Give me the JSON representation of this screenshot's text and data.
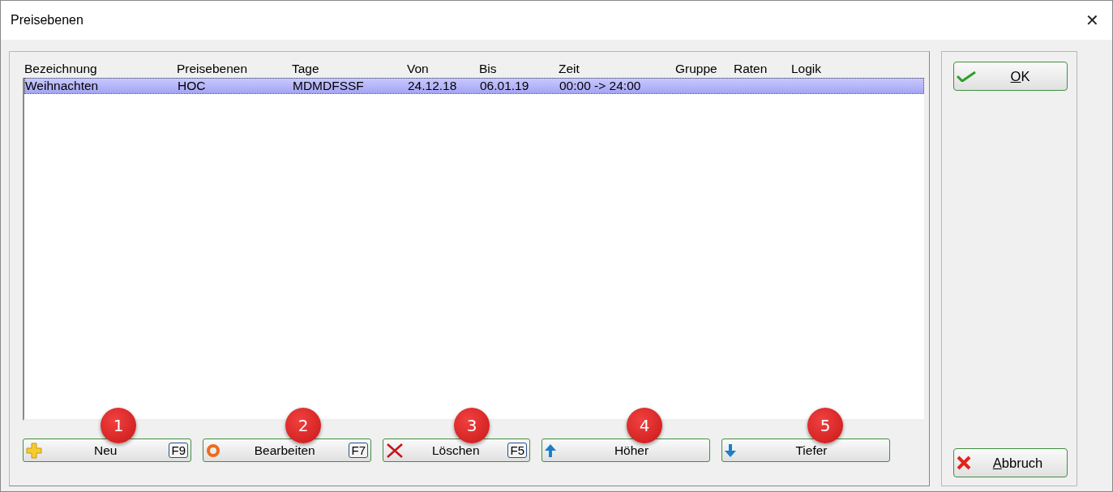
{
  "window": {
    "title": "Preisebenen",
    "close": "✕"
  },
  "table": {
    "columns": [
      "Bezeichnung",
      "Preisebenen",
      "Tage",
      "Von",
      "Bis",
      "Zeit",
      "Gruppe",
      "Raten",
      "Logik"
    ],
    "rows": [
      {
        "selected": true,
        "cells": [
          "Weihnachten",
          "HOC",
          "MDMDFSSF",
          "24.12.18",
          "06.01.19",
          "00:00 -> 24:00",
          "",
          "",
          ""
        ]
      }
    ]
  },
  "buttons": [
    {
      "kind": "plus",
      "label": "Neu",
      "key": "F9",
      "marker": "1"
    },
    {
      "kind": "ring",
      "label": "Bearbeiten",
      "key": "F7",
      "marker": "2"
    },
    {
      "kind": "cross",
      "label": "Löschen",
      "key": "F5",
      "marker": "3"
    },
    {
      "kind": "up",
      "label": "Höher",
      "marker": "4"
    },
    {
      "kind": "down",
      "label": "Tiefer",
      "marker": "5"
    }
  ],
  "side_buttons": [
    {
      "kind": "check",
      "label": "OK"
    },
    {
      "kind": "cancel",
      "label": "Abbruch"
    }
  ]
}
